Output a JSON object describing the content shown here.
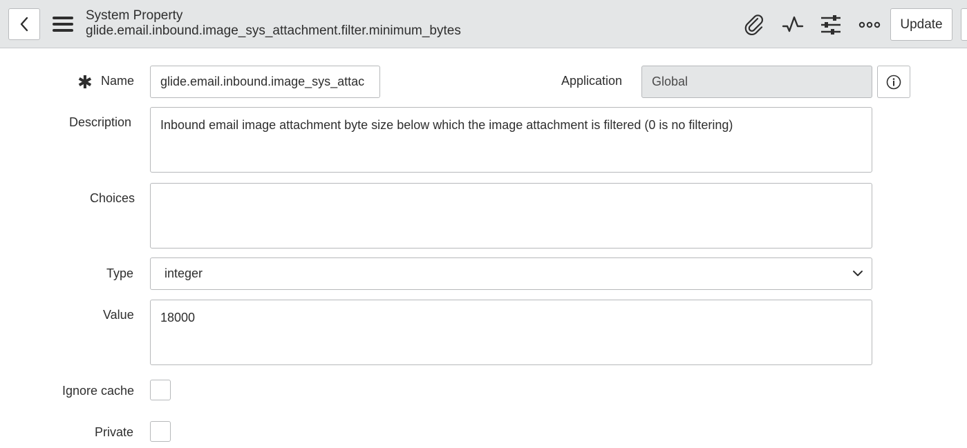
{
  "header": {
    "title": "System Property",
    "subtitle": "glide.email.inbound.image_sys_attachment.filter.minimum_bytes",
    "update_label": "Update",
    "icons": [
      "back-icon",
      "hamburger-menu-icon",
      "paperclip-icon",
      "activity-icon",
      "sliders-icon",
      "more-options-icon"
    ]
  },
  "form": {
    "name": {
      "label": "Name",
      "required_marker": "✱",
      "value": "glide.email.inbound.image_sys_attac"
    },
    "application": {
      "label": "Application",
      "value": "Global"
    },
    "description": {
      "label": "Description",
      "value": "Inbound email image attachment byte size below which the image attachment is filtered (0 is no filtering)"
    },
    "choices": {
      "label": "Choices",
      "value": ""
    },
    "type": {
      "label": "Type",
      "value": "integer"
    },
    "value": {
      "label": "Value",
      "value": "18000"
    },
    "ignore_cache": {
      "label": "Ignore cache",
      "checked": false
    },
    "private": {
      "label": "Private",
      "checked": false
    }
  },
  "colors": {
    "header_bg": "#e4e6e7",
    "border": "#b6b8ba",
    "text": "#2e2e2e"
  }
}
